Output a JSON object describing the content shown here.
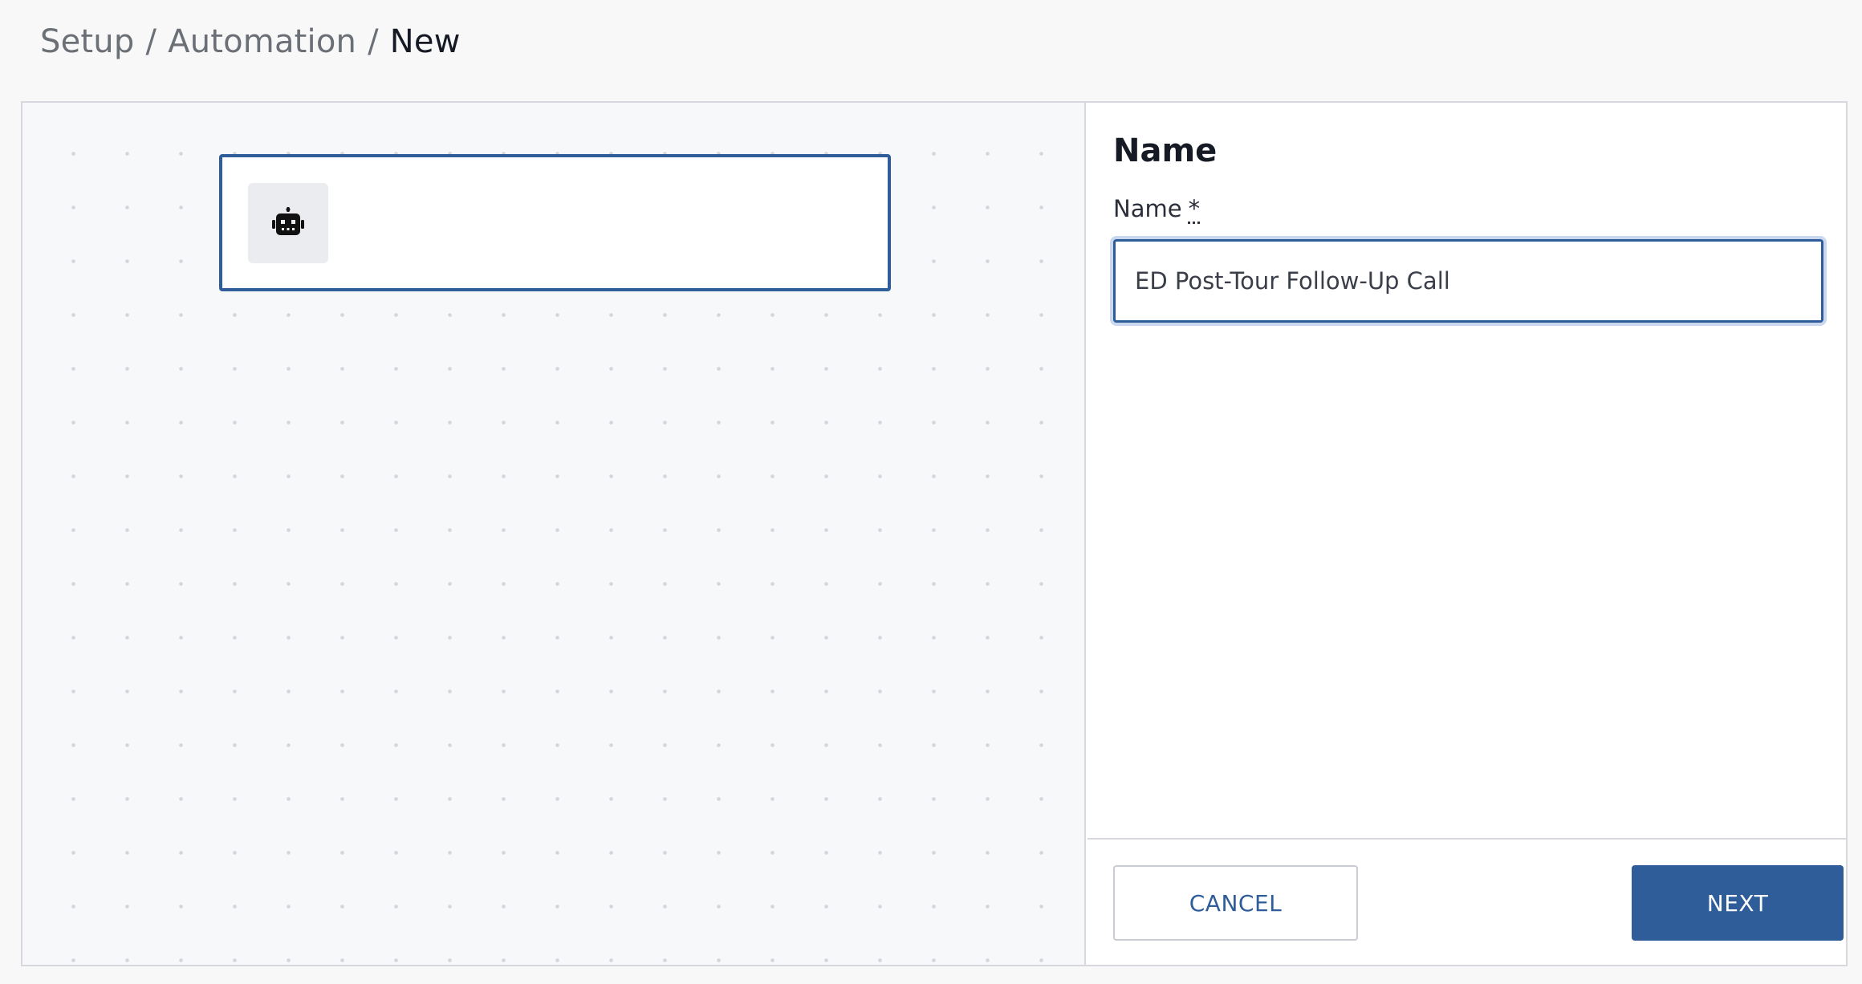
{
  "breadcrumb": {
    "items": [
      "Setup",
      "Automation"
    ],
    "separator": "/",
    "current": "New"
  },
  "canvas": {
    "trigger_node": {
      "icon": "robot-icon",
      "label": ""
    }
  },
  "panel": {
    "title": "Name",
    "field": {
      "label": "Name",
      "required_marker": "*",
      "value": "ED Post-Tour Follow-Up Call"
    },
    "buttons": {
      "cancel": "CANCEL",
      "next": "NEXT"
    }
  },
  "colors": {
    "accent": "#2f5d9a",
    "canvas_bg": "#f7f8fa",
    "border": "#d6d8de"
  }
}
